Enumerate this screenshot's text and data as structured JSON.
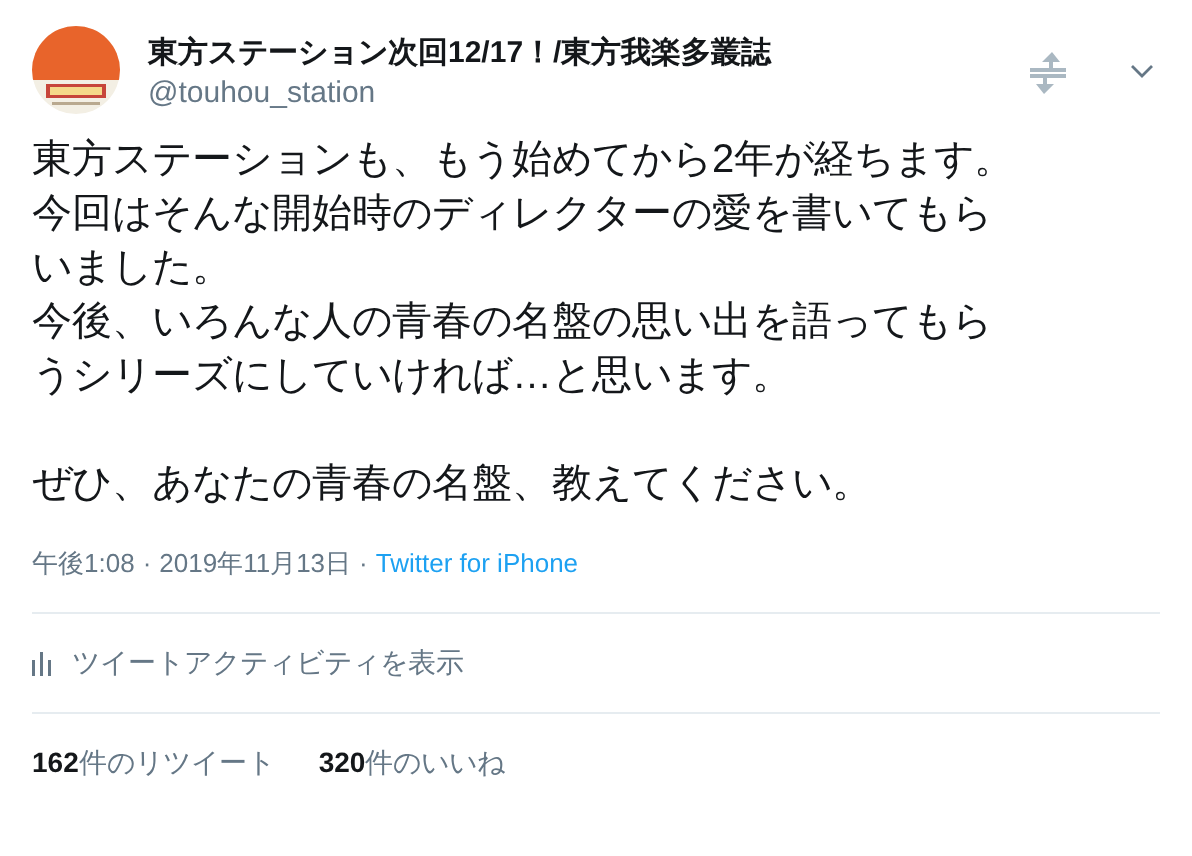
{
  "tweet": {
    "author": {
      "name": "東方ステーション次回12/17！/東方我楽多叢誌",
      "handle": "@touhou_station"
    },
    "paragraphs": [
      [
        "東方ステーションも、もう始めてから2年が経ちます。",
        "今回はそんな開始時のディレクターの愛を書いてもら",
        "いました。",
        "今後、いろんな人の青春の名盤の思い出を語ってもら",
        "うシリーズにしていければ…と思います。"
      ],
      [
        "ぜひ、あなたの青春の名盤、教えてください。"
      ]
    ],
    "time": "午後1:08",
    "separator": "·",
    "date": "2019年11月13日",
    "source": "Twitter for iPhone",
    "activity_link": "ツイートアクティビティを表示",
    "stats": [
      "**162**件のリツイート",
      "**320**件のいいね"
    ]
  }
}
